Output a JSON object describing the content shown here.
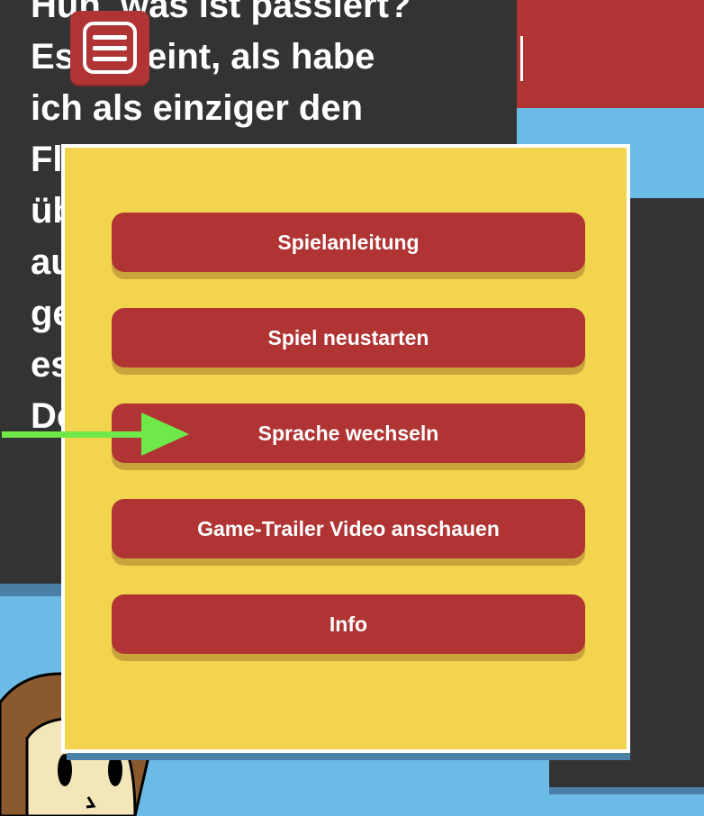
{
  "story": {
    "lines": "Huh, was ist passiert?\nEs scheint, als habe\nich als einziger den\nFlugzeugabsturz\nüberlebt. Ich muss\naus dem Dschungel\ngelangen, bevor\nes zu spät ist!\nDer"
  },
  "menu": {
    "icon": "hamburger-icon",
    "items": [
      {
        "label": "Spielanleitung"
      },
      {
        "label": "Spiel neustarten"
      },
      {
        "label": "Sprache wechseln"
      },
      {
        "label": "Game-Trailer Video anschauen"
      },
      {
        "label": "Info"
      }
    ]
  },
  "colors": {
    "menu_button": "#b03434",
    "popup_bg": "#f2d44e",
    "panel_bg": "#333333",
    "sky": "#6cbbe6",
    "arrow": "#6fe84a"
  }
}
